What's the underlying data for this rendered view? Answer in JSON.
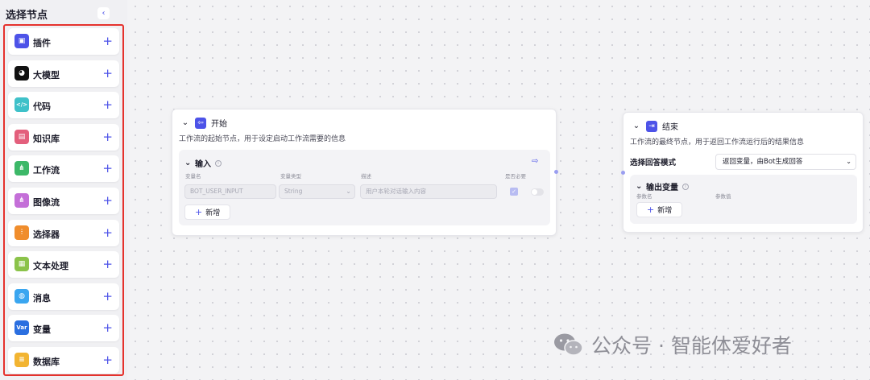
{
  "sidebar": {
    "title": "选择节点",
    "collapse_icon": "‹",
    "items": [
      {
        "label": "插件",
        "icon": "plugin-icon",
        "glyph": "▣",
        "color": "#4d53e8"
      },
      {
        "label": "大模型",
        "icon": "llm-icon",
        "glyph": "◕",
        "color": "#111111"
      },
      {
        "label": "代码",
        "icon": "code-icon",
        "glyph": "</>",
        "color": "#3fc1c9"
      },
      {
        "label": "知识库",
        "icon": "knowledge-icon",
        "glyph": "▤",
        "color": "#e35f7c"
      },
      {
        "label": "工作流",
        "icon": "workflow-icon",
        "glyph": "⋔",
        "color": "#3cb868"
      },
      {
        "label": "图像流",
        "icon": "imageflow-icon",
        "glyph": "⋔",
        "color": "#c46fd8"
      },
      {
        "label": "选择器",
        "icon": "selector-icon",
        "glyph": "⫶",
        "color": "#f08d2c"
      },
      {
        "label": "文本处理",
        "icon": "text-process-icon",
        "glyph": "▦",
        "color": "#8bc34a"
      },
      {
        "label": "消息",
        "icon": "message-icon",
        "glyph": "◍",
        "color": "#3aa6f0"
      },
      {
        "label": "变量",
        "icon": "variable-icon",
        "glyph": "Var",
        "color": "#2b6fe0"
      },
      {
        "label": "数据库",
        "icon": "database-icon",
        "glyph": "≡",
        "color": "#f2b431"
      }
    ],
    "add_glyph": "+"
  },
  "start_node": {
    "title": "开始",
    "description": "工作流的起始节点，用于设定启动工作流需要的信息",
    "input_section": {
      "title": "输入",
      "columns": [
        "变量名",
        "变量类型",
        "描述",
        "是否必要"
      ],
      "row": {
        "name_value": "BOT_USER_INPUT",
        "type_value": "String",
        "description_placeholder": "用户本轮对话输入内容",
        "required_checked": true
      },
      "add_label": "新增"
    }
  },
  "end_node": {
    "title": "结束",
    "description": "工作流的最终节点，用于返回工作流运行后的结果信息",
    "mode_label": "选择回答模式",
    "mode_value": "返回变量，由Bot生成回答",
    "output_section": {
      "title": "输出变量",
      "columns": [
        "参数名",
        "参数值"
      ],
      "add_label": "新增"
    }
  },
  "watermark": {
    "text": "公众号 · 智能体爱好者"
  }
}
